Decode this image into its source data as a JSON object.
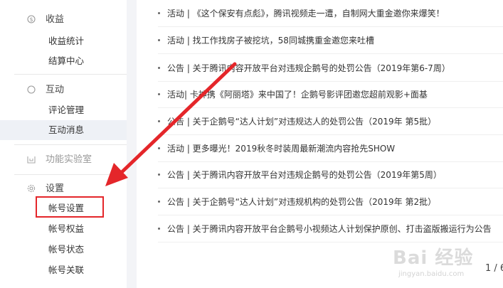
{
  "sidebar": {
    "groups": [
      {
        "icon": "dollar-circle-icon",
        "label": "收益",
        "items": [
          "收益统计",
          "结算中心"
        ]
      },
      {
        "icon": "circle-icon",
        "label": "互动",
        "items": [
          "评论管理",
          "互动消息"
        ]
      },
      {
        "icon": "lab-icon",
        "label": "功能实验室",
        "items": []
      },
      {
        "icon": "gear-icon",
        "label": "设置",
        "items": [
          "帐号设置",
          "帐号权益",
          "帐号状态",
          "帐号关联"
        ]
      }
    ],
    "active_item": "互动消息",
    "highlighted_item": "帐号设置"
  },
  "announcements": [
    "活动 | 《这个保安有点彪》，腾讯视频走一遭，自制网大重金邀你来爆笑！",
    "活动 | 找工作找房子被挖坑，58同城携重金邀您来吐槽",
    "公告 | 关于腾讯内容开放平台对违规企鹅号的处罚公告（2019年第6-7周）",
    "活动| 卡神携《阿丽塔》来中国了！企鹅号影评团邀您超前观影+面基",
    "公告 | 关于企鹅号“达人计划”对违规达人的处罚公告（2019年 第5批）",
    "活动 | 更多曝光！2019秋冬时装周最新潮流内容抢先SHOW",
    "公告 | 关于腾讯内容开放平台对违规企鹅号的处罚公告（2019年第5周）",
    "公告 | 关于企鹅号“达人计划”对违规机构的处罚公告（2019年 第2批）",
    "公告 | 关于腾讯内容开放平台企鹅号小视频达人计划保护原创、打击盗版搬运行为公告"
  ],
  "pager": {
    "text": "1 / 6"
  },
  "watermark": {
    "logo": "Bai 经验",
    "url": "jingyan.baidu.com"
  },
  "colors": {
    "annotation": "#e4262a",
    "active_bg": "#eef1f6",
    "page_bg": "#f3f4f7"
  }
}
